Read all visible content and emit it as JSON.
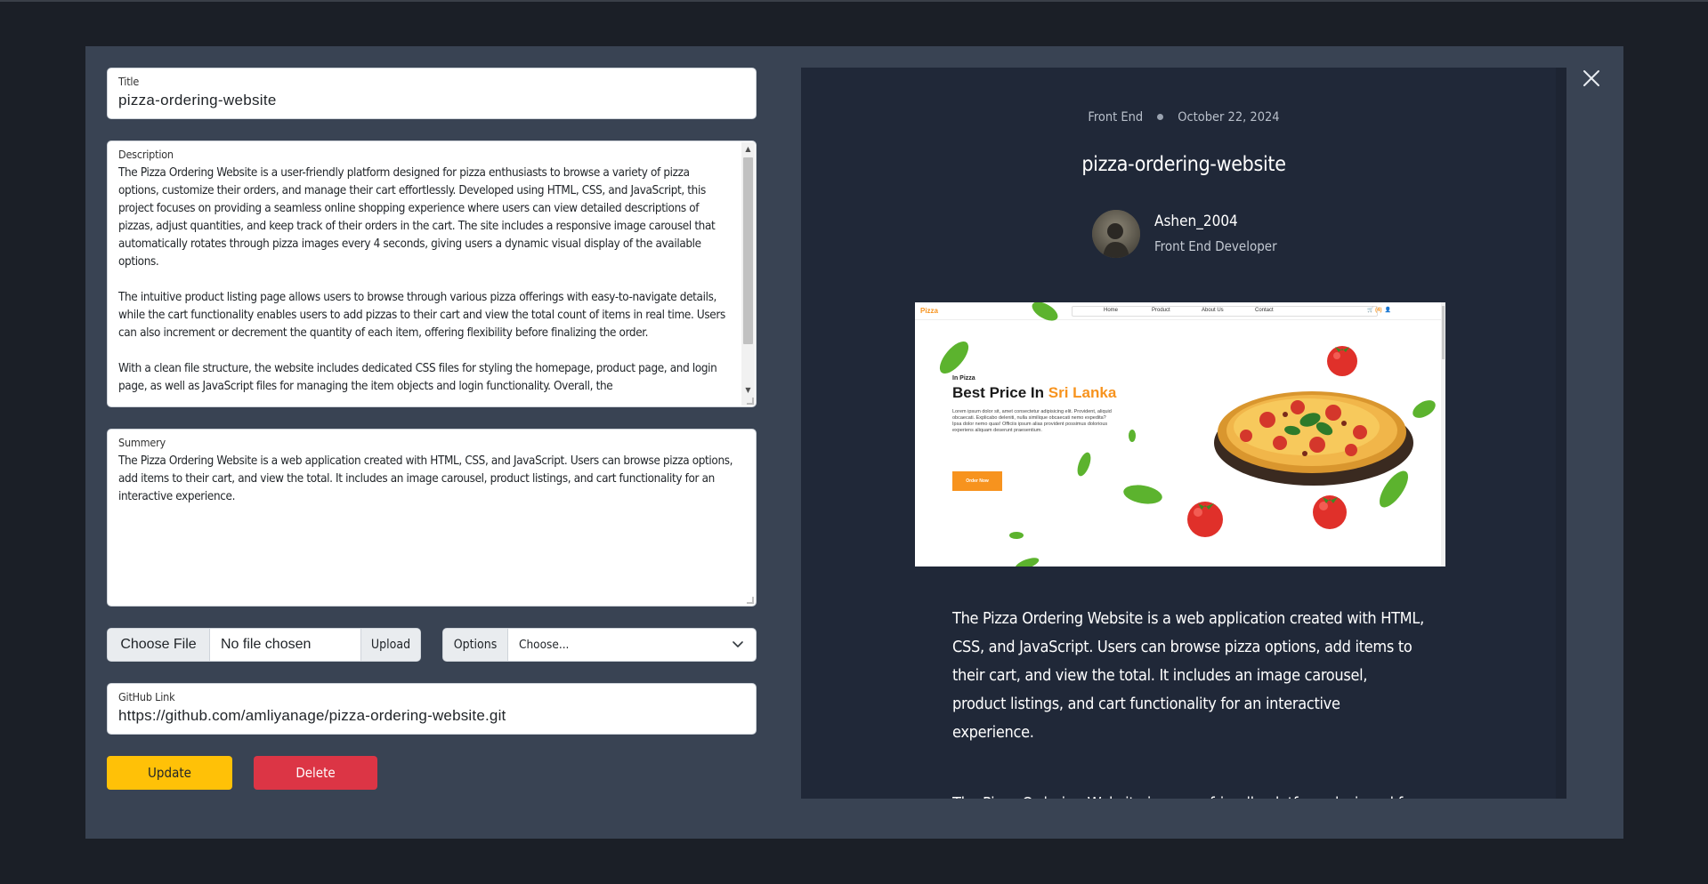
{
  "form": {
    "title_label": "Title",
    "title_value": "pizza-ordering-website",
    "description_label": "Description",
    "description_value": "The Pizza Ordering Website is a user-friendly platform designed for pizza enthusiasts to browse a variety of pizza options, customize their orders, and manage their cart effortlessly. Developed using HTML, CSS, and JavaScript, this project focuses on providing a seamless online shopping experience where users can view detailed descriptions of pizzas, adjust quantities, and keep track of their orders in the cart. The site includes a responsive image carousel that automatically rotates through pizza images every 4 seconds, giving users a dynamic visual display of the available options.\n\nThe intuitive product listing page allows users to browse through various pizza offerings with easy-to-navigate details, while the cart functionality enables users to add pizzas to their cart and view the total count of items in real time. Users can also increment or decrement the quantity of each item, offering flexibility before finalizing the order.\n\nWith a clean file structure, the website includes dedicated CSS files for styling the homepage, product page, and login page, as well as JavaScript files for managing the item objects and login functionality. Overall, the",
    "summary_label": "Summery",
    "summary_value": "The Pizza Ordering Website is a web application created with HTML, CSS, and JavaScript. Users can browse pizza options, add items to their cart, and view the total. It includes an image carousel, product listings, and cart functionality for an interactive experience.",
    "choose_file_label": "Choose File",
    "no_file_label": "No file chosen",
    "upload_label": "Upload",
    "options_label": "Options",
    "options_selected": "Choose...",
    "github_label": "GitHub Link",
    "github_value": "https://github.com/amliyanage/pizza-ordering-website.git",
    "update_label": "Update",
    "delete_label": "Delete"
  },
  "preview": {
    "category": "Front End",
    "date": "October 22, 2024",
    "title": "pizza-ordering-website",
    "author_name": "Ashen_2004",
    "author_role": "Front End Developer",
    "summary": "The Pizza Ordering Website is a web application created with HTML, CSS, and JavaScript. Users can browse pizza options, add items to their cart, and view the total. It includes an image carousel, product listings, and cart functionality for an interactive experience.",
    "next_paragraph": "The Pizza Ordering Website is a user-friendly platform designed for",
    "screenshot": {
      "logo": "Pizza",
      "nav": [
        "Home",
        "Product",
        "About Us",
        "Contact"
      ],
      "cart_count": "(4)",
      "small_heading": "In Pizza",
      "big_heading": "Best Price In",
      "big_heading_accent": "Sri Lanka",
      "lorem": "Lorem ipsum dolor sit, amet consectetur adipisicing elit. Provident, aliquid obcaecati. Explicabo deleniti, nulla similique obcaecati nemo expedita? Ipsa dolor nemo quas! Officiis ipsum alias provident possimus dolorious experiens aliquam deserunt praesentium.",
      "order_button": "Order Now"
    }
  },
  "colors": {
    "modal_bg": "#394353",
    "preview_bg": "#202838",
    "update": "#ffc107",
    "delete": "#dc3545",
    "accent_orange": "#f7931e"
  },
  "icons": [
    "close-icon",
    "chevron-down-icon",
    "scroll-up-icon",
    "scroll-down-icon",
    "cart-icon",
    "user-icon"
  ]
}
